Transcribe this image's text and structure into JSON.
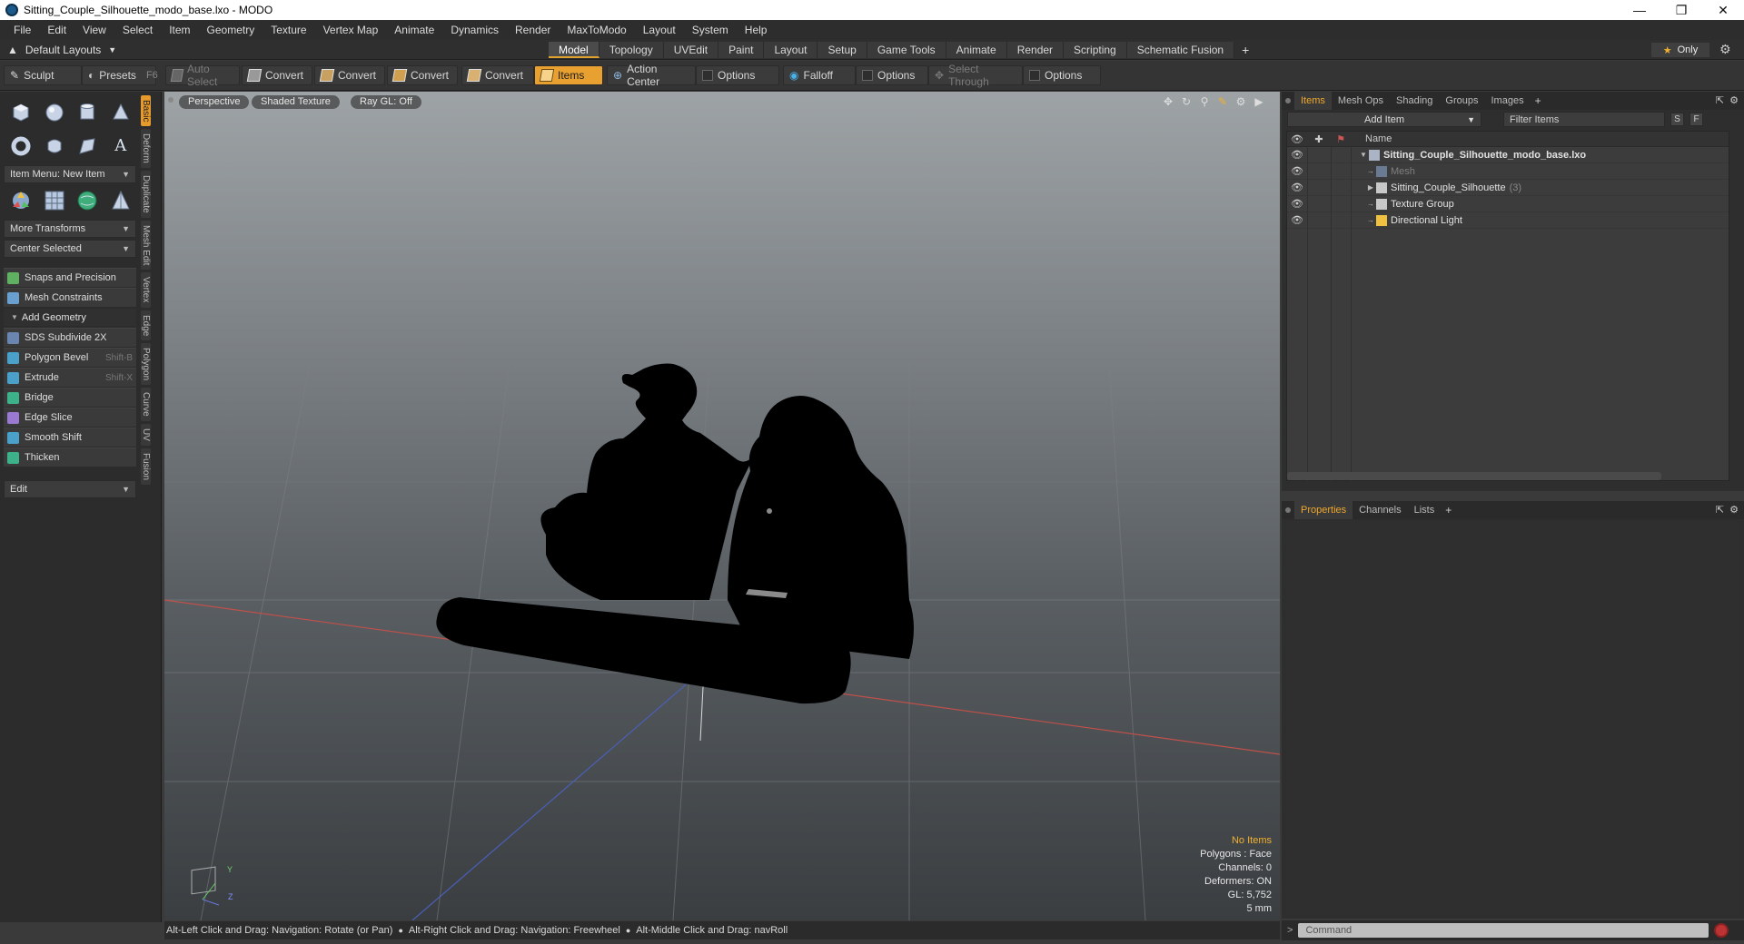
{
  "window": {
    "title": "Sitting_Couple_Silhouette_modo_base.lxo - MODO",
    "minimize": "—",
    "restore": "❐",
    "close": "✕"
  },
  "menu": [
    "File",
    "Edit",
    "View",
    "Select",
    "Item",
    "Geometry",
    "Texture",
    "Vertex Map",
    "Animate",
    "Dynamics",
    "Render",
    "MaxToModo",
    "Layout",
    "System",
    "Help"
  ],
  "layout_bar": {
    "layouts_label": "Default Layouts",
    "tabs": [
      "Model",
      "Topology",
      "UVEdit",
      "Paint",
      "Layout",
      "Setup",
      "Game Tools",
      "Animate",
      "Render",
      "Scripting",
      "Schematic Fusion"
    ],
    "active_tab": "Model",
    "add": "+",
    "only_label": "Only"
  },
  "toolbar": {
    "sculpt": "Sculpt",
    "presets": "Presets",
    "presets_key": "F6",
    "auto_select": "Auto Select",
    "convert1": "Convert",
    "convert2": "Convert",
    "convert3": "Convert",
    "convert4": "Convert",
    "items": "Items",
    "action_center": "Action Center",
    "options1": "Options",
    "falloff": "Falloff",
    "options2": "Options",
    "select_through": "Select Through",
    "options3": "Options"
  },
  "left_panel": {
    "item_menu": "Item Menu: New Item",
    "more_transforms": "More Transforms",
    "center_selected": "Center Selected",
    "snaps": "Snaps and Precision",
    "mesh_constraints": "Mesh Constraints",
    "add_geometry": "Add Geometry",
    "tools": [
      {
        "label": "SDS Subdivide 2X",
        "shortcut": "",
        "color": "#6a86b0"
      },
      {
        "label": "Polygon Bevel",
        "shortcut": "Shift-B",
        "color": "#4aa0c8"
      },
      {
        "label": "Extrude",
        "shortcut": "Shift-X",
        "color": "#4aa0c8"
      },
      {
        "label": "Bridge",
        "shortcut": "",
        "color": "#3db28a"
      },
      {
        "label": "Edge Slice",
        "shortcut": "",
        "color": "#9a7ad0"
      },
      {
        "label": "Smooth Shift",
        "shortcut": "",
        "color": "#4aa0c8"
      },
      {
        "label": "Thicken",
        "shortcut": "",
        "color": "#3db28a"
      }
    ],
    "edit_dd": "Edit",
    "vertical_tabs": [
      "Basic",
      "Deform",
      "Duplicate",
      "Mesh Edit",
      "Vertex",
      "Edge",
      "Polygon",
      "Curve",
      "UV",
      "Fusion"
    ],
    "active_vtab": "Basic"
  },
  "viewport": {
    "perspective": "Perspective",
    "shaded": "Shaded Texture",
    "raygl": "Ray GL: Off",
    "info": {
      "no_items": "No Items",
      "polygons": "Polygons : Face",
      "channels": "Channels: 0",
      "deformers": "Deformers: ON",
      "gl": "GL: 5,752",
      "scale": "5 mm"
    },
    "axis_y": "Y",
    "axis_z": "Z"
  },
  "statusbar": {
    "hint1": "Alt-Left Click and Drag: Navigation: Rotate (or Pan)",
    "hint2": "Alt-Right Click and Drag: Navigation: Freewheel",
    "hint3": "Alt-Middle Click and Drag: navRoll"
  },
  "items_panel": {
    "tabs": [
      "Items",
      "Mesh Ops",
      "Shading",
      "Groups",
      "Images"
    ],
    "active_tab": "Items",
    "add": "+",
    "add_item": "Add Item",
    "filter_placeholder": "Filter Items",
    "s_btn": "S",
    "f_btn": "F",
    "name_header": "Name",
    "tree": [
      {
        "label": "Sitting_Couple_Silhouette_modo_base.lxo",
        "count": "",
        "type": "scene"
      },
      {
        "label": "Mesh",
        "count": "",
        "type": "mesh"
      },
      {
        "label": "Sitting_Couple_Silhouette",
        "count": "(3)",
        "type": "group"
      },
      {
        "label": "Texture Group",
        "count": "",
        "type": "texture"
      },
      {
        "label": "Directional Light",
        "count": "",
        "type": "light"
      }
    ]
  },
  "props_panel": {
    "tabs": [
      "Properties",
      "Channels",
      "Lists"
    ],
    "active_tab": "Properties",
    "add": "+"
  },
  "command": {
    "prompt": ">",
    "placeholder": "Command"
  }
}
